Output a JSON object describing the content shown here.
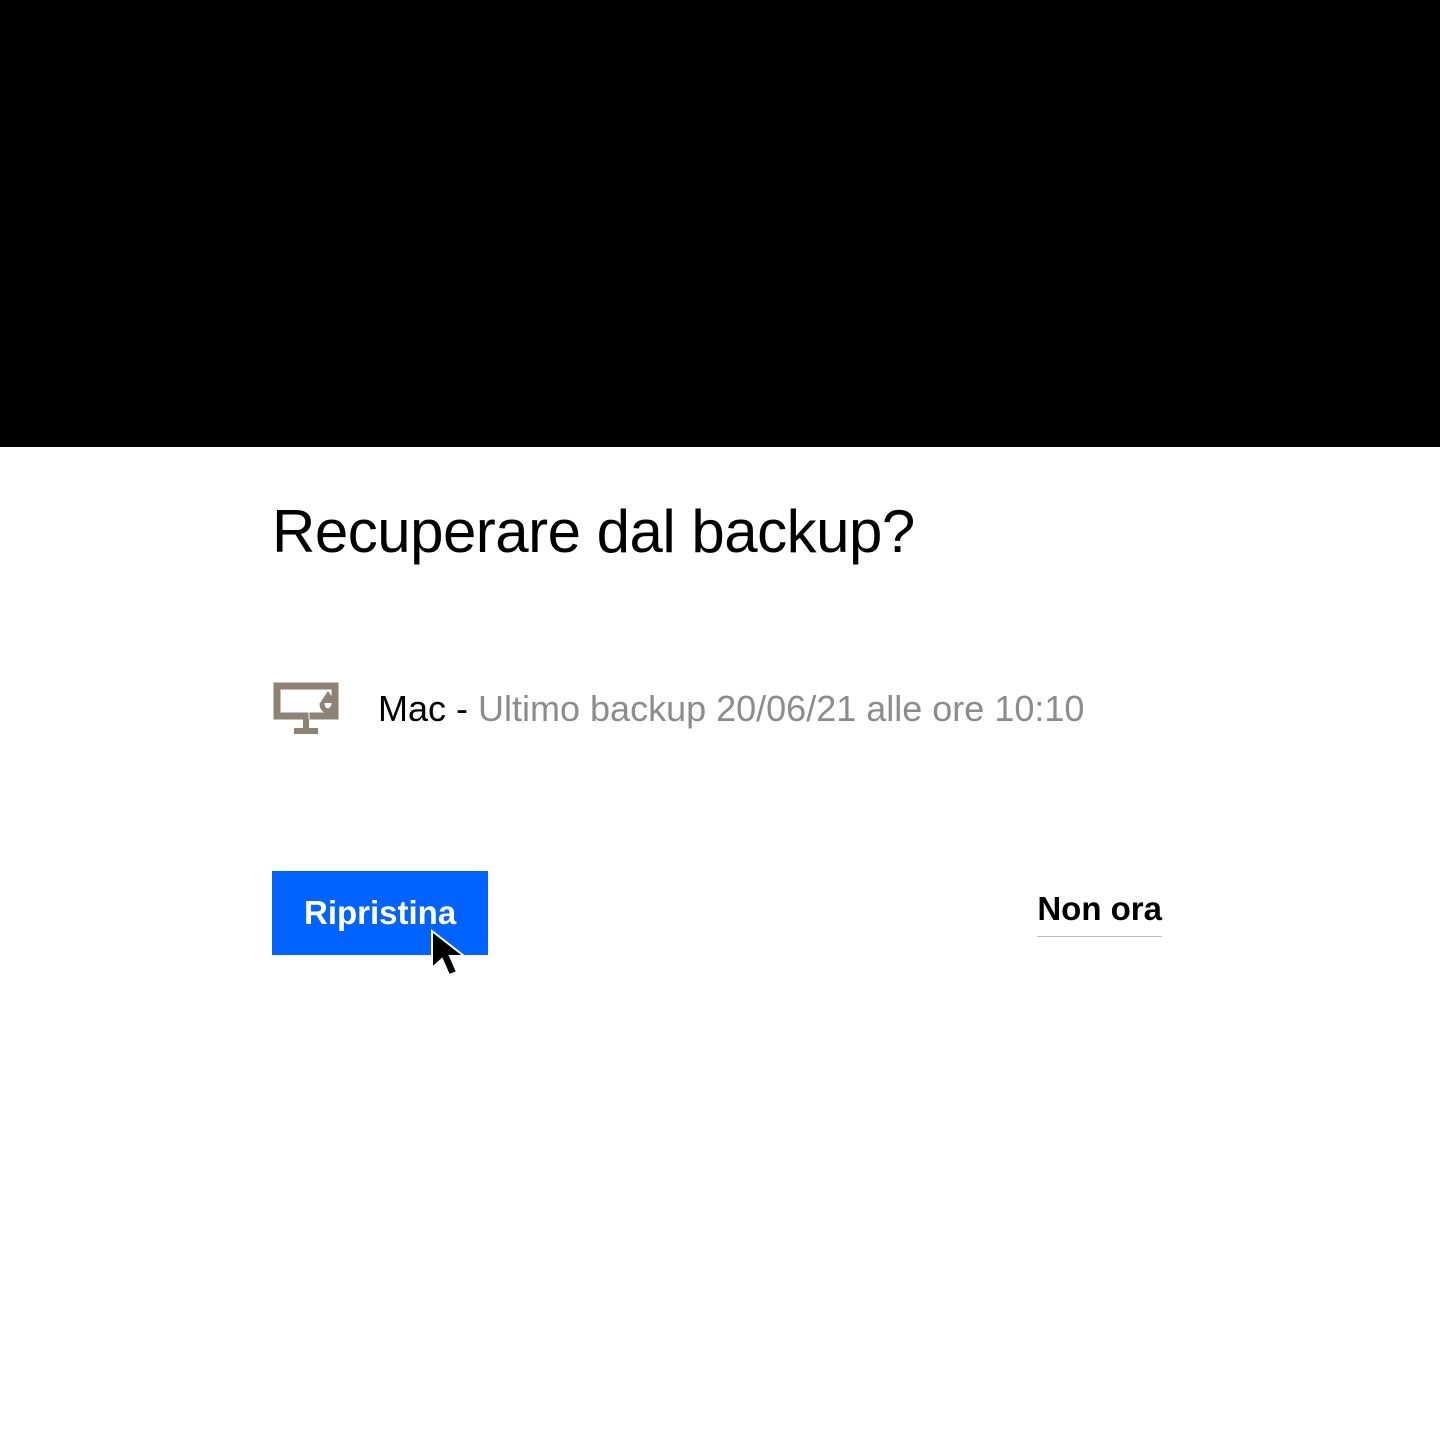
{
  "dialog": {
    "title": "Recuperare dal backup?",
    "device_name": "Mac",
    "separator": " - ",
    "backup_detail": "Ultimo backup 20/06/21 alle ore 10:10",
    "primary_button": "Ripristina",
    "secondary_button": "Non ora"
  },
  "colors": {
    "primary": "#0062ff",
    "icon": "#8c8275",
    "muted": "#8c8c8c"
  }
}
